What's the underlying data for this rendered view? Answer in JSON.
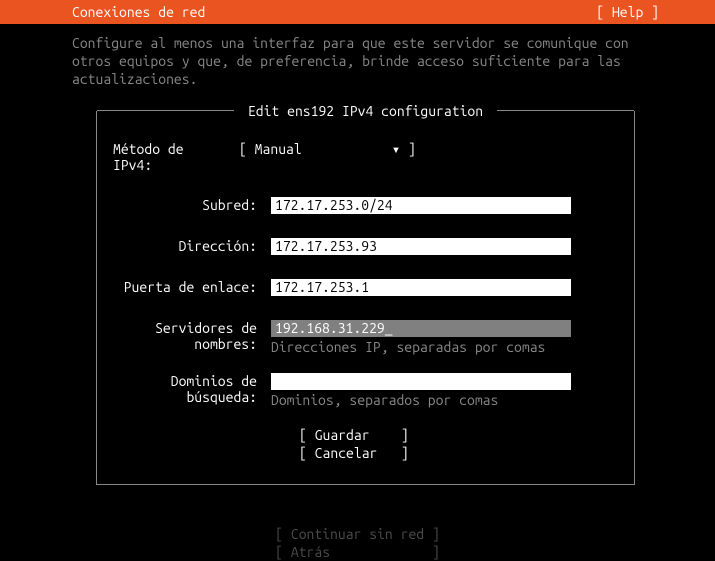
{
  "header": {
    "title": "Conexiones de red",
    "help": "[ Help ]"
  },
  "description": "Configure al menos una interfaz para que este servidor se comunique con otros equipos y que, de preferencia, brinde acceso suficiente para las actualizaciones.",
  "dialog": {
    "title": " Edit ens192 IPv4 configuration ",
    "method_label": "Método de IPv4:",
    "method_value": "[ Manual",
    "method_caret": "▾ ]",
    "fields": {
      "subnet": {
        "label": "Subred:",
        "value": "172.17.253.0/24"
      },
      "address": {
        "label": "Dirección:",
        "value": "172.17.253.93"
      },
      "gateway": {
        "label": "Puerta de enlace:",
        "value": "172.17.253.1"
      },
      "nameservers": {
        "label": "Servidores de nombres:",
        "value": "192.168.31.229_",
        "hint": "Direcciones IP, separadas por comas"
      },
      "searchdomains": {
        "label": "Dominios de búsqueda:",
        "value": "",
        "hint": "Dominios, separados por comas"
      }
    },
    "actions": {
      "save": "[ Guardar    ]",
      "cancel": "[ Cancelar   ]"
    }
  },
  "footer": {
    "continue": "[ Continuar sin red ]",
    "back": "[ Atrás             ]"
  }
}
